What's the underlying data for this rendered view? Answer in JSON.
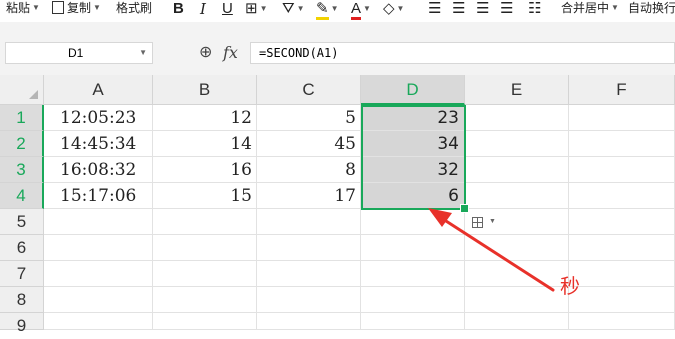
{
  "toolbar": {
    "paste": "粘贴",
    "copy": "复制",
    "format_painter": "格式刷",
    "bold": "B",
    "italic": "I",
    "underline": "U",
    "font_color_letter": "A",
    "merge_center": "合并居中",
    "auto_wrap": "自动换行"
  },
  "formula_bar": {
    "name_box": "D1",
    "fx": "fx",
    "formula": "=SECOND(A1)"
  },
  "sheet": {
    "columns": [
      "A",
      "B",
      "C",
      "D",
      "E",
      "F"
    ],
    "rows": [
      "1",
      "2",
      "3",
      "4",
      "5",
      "6",
      "7",
      "8",
      "9"
    ],
    "selected_column": "D",
    "cells": {
      "A": [
        "12:05:23",
        "14:45:34",
        "16:08:32",
        "15:17:06"
      ],
      "B": [
        "12",
        "14",
        "16",
        "15"
      ],
      "C": [
        "5",
        "45",
        "8",
        "17"
      ],
      "D": [
        "23",
        "34",
        "32",
        "6"
      ]
    }
  },
  "annotation": {
    "text": "秒",
    "color": "#e8312a"
  },
  "colors": {
    "accent": "#19a85a",
    "arrow": "#e8312a"
  }
}
